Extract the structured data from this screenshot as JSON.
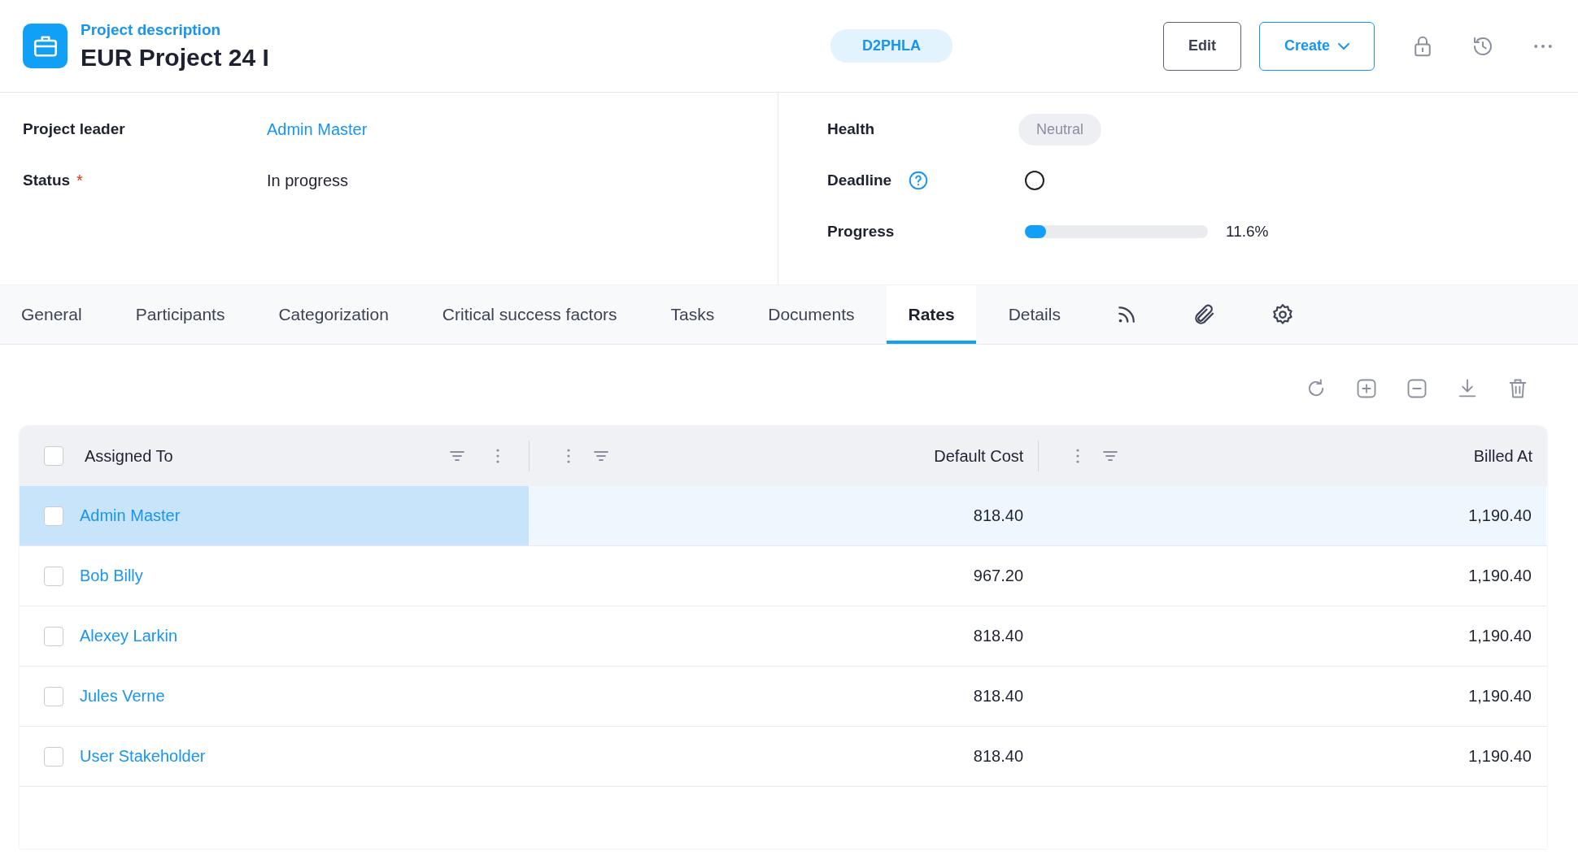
{
  "header": {
    "subtitle": "Project description",
    "title": "EUR Project 24 I",
    "code": "D2PHLA",
    "buttons": [
      {
        "label": "Edit",
        "kind": "plain"
      },
      {
        "label": "Create",
        "kind": "dropdown"
      }
    ]
  },
  "fields_left": [
    {
      "label": "Project leader",
      "value": "Admin Master",
      "kind": "link"
    },
    {
      "label": "Status",
      "value": "In progress",
      "kind": "text",
      "required_mark": "*"
    }
  ],
  "fields_right": [
    {
      "label": "Health",
      "value": "Neutral",
      "kind": "pill",
      "help": false
    },
    {
      "label": "Deadline",
      "kind": "radio",
      "help": true,
      "checked": false
    },
    {
      "label": "Progress",
      "kind": "progress",
      "level": 0.116,
      "reading": "11.6%",
      "help": false
    }
  ],
  "tabs": [
    {
      "label": "General",
      "kind": "text",
      "selected": false
    },
    {
      "label": "Participants",
      "kind": "text",
      "selected": false
    },
    {
      "label": "Categorization",
      "kind": "text",
      "selected": false
    },
    {
      "label": "Critical success factors",
      "kind": "text",
      "selected": false
    },
    {
      "label": "Tasks",
      "kind": "text",
      "selected": false
    },
    {
      "label": "Documents",
      "kind": "text",
      "selected": false
    },
    {
      "label": "Rates",
      "kind": "text",
      "selected": true
    },
    {
      "label": "Details",
      "kind": "text",
      "selected": false
    },
    {
      "kind": "feed",
      "selected": false
    },
    {
      "kind": "attachment",
      "selected": false
    },
    {
      "kind": "settings",
      "selected": false
    }
  ],
  "toolbar": [
    {
      "kind": "refresh"
    },
    {
      "kind": "add"
    },
    {
      "kind": "remove"
    },
    {
      "kind": "download"
    },
    {
      "kind": "delete"
    }
  ],
  "table": {
    "all_checked": false,
    "columns": [
      "Assigned To",
      "Default Cost",
      "Billed At"
    ],
    "rows": [
      {
        "assigned_to": "Admin Master",
        "default_cost": "818.40",
        "billed_at": "1,190.40",
        "selected": true,
        "checked": false
      },
      {
        "assigned_to": "Bob Billy",
        "default_cost": "967.20",
        "billed_at": "1,190.40",
        "selected": false,
        "checked": false
      },
      {
        "assigned_to": "Alexey Larkin",
        "default_cost": "818.40",
        "billed_at": "1,190.40",
        "selected": false,
        "checked": false
      },
      {
        "assigned_to": "Jules Verne",
        "default_cost": "818.40",
        "billed_at": "1,190.40",
        "selected": false,
        "checked": false
      },
      {
        "assigned_to": "User Stakeholder",
        "default_cost": "818.40",
        "billed_at": "1,190.40",
        "selected": false,
        "checked": false
      }
    ]
  }
}
